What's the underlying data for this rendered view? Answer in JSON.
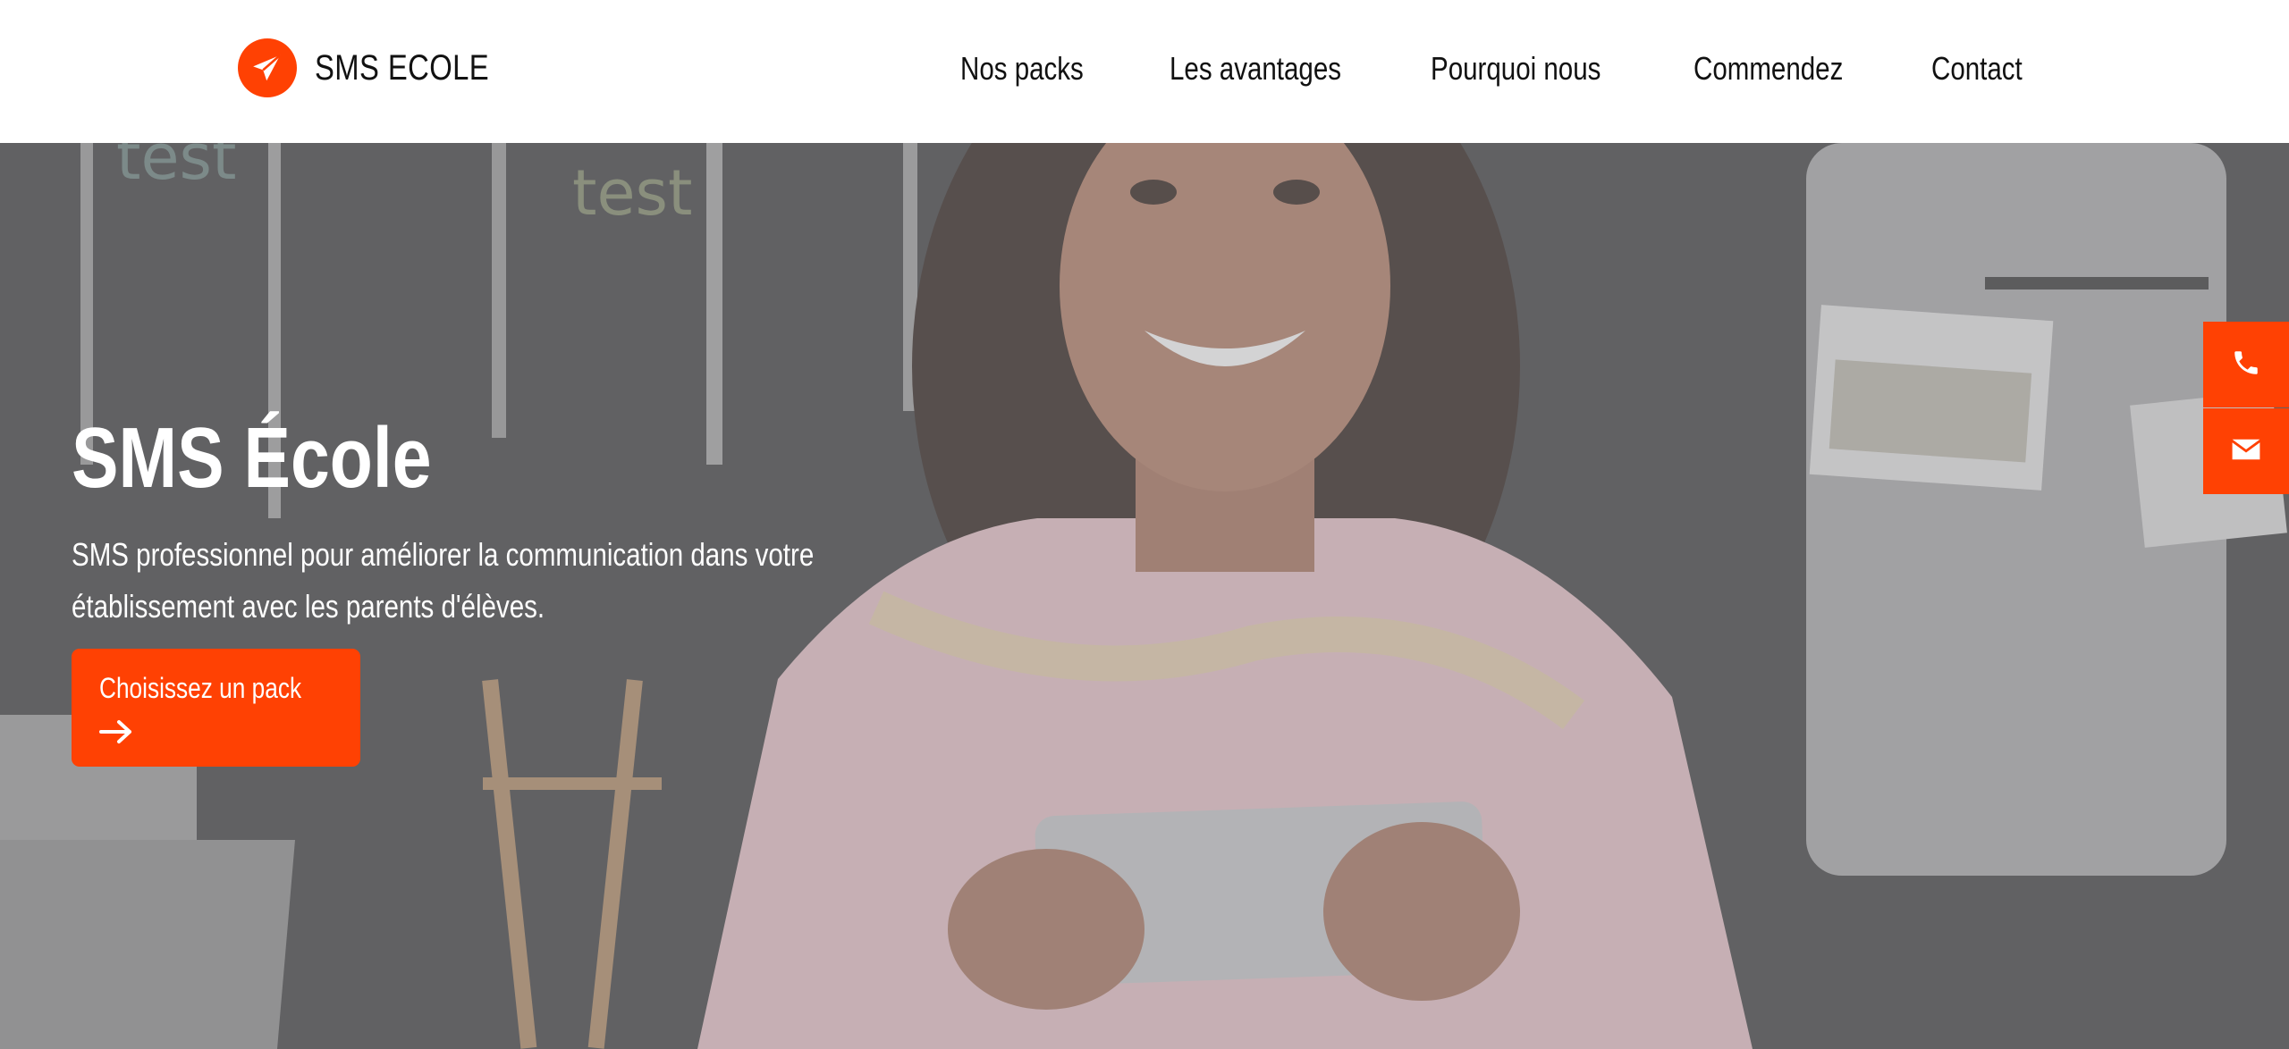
{
  "brand": {
    "name": "SMS ECOLE",
    "logo_icon": "paper-plane-icon",
    "accent_color": "#ff4103"
  },
  "nav": {
    "items": [
      {
        "label": "Nos packs"
      },
      {
        "label": "Les avantages"
      },
      {
        "label": "Pourquoi nous"
      },
      {
        "label": "Commendez"
      },
      {
        "label": "Contact"
      }
    ]
  },
  "hero": {
    "title": "SMS École",
    "subtitle": "SMS professionnel pour améliorer la communication dans votre établissement avec les parents d'élèves.",
    "cta_label": "Choisissez un pack",
    "cta_icon": "arrow-right-icon"
  },
  "side_actions": {
    "phone_icon": "phone-icon",
    "mail_icon": "envelope-icon"
  }
}
